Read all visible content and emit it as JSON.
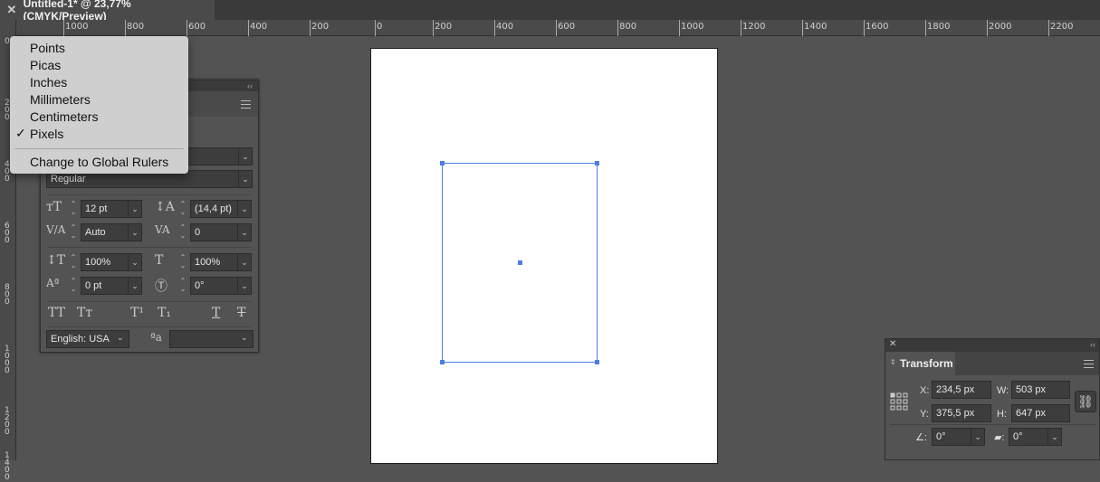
{
  "document_tab": {
    "close_icon": "close-icon",
    "title": "Untitled-1* @ 23,77% (CMYK/Preview)"
  },
  "ruler": {
    "h_labels": [
      "1000",
      "800",
      "600",
      "400",
      "200",
      "0",
      "200",
      "400",
      "600",
      "800",
      "1000",
      "1200",
      "1400",
      "1600",
      "1800",
      "2000",
      "2200"
    ],
    "v_labels": [
      "0",
      "200",
      "400",
      "600",
      "800",
      "1000",
      "1200",
      "1400"
    ]
  },
  "units_menu": {
    "items": [
      "Points",
      "Picas",
      "Inches",
      "Millimeters",
      "Centimeters",
      "Pixels"
    ],
    "checked": "Pixels",
    "check_glyph": "✓",
    "global": "Change to Global Rulers"
  },
  "character_panel": {
    "collapse": "‹‹",
    "font_style": "Regular",
    "font_size": "12 pt",
    "leading": "(14,4 pt)",
    "kerning": "Auto",
    "tracking": "0",
    "vertical_scale": "100%",
    "horizontal_scale": "100%",
    "baseline_shift": "0 pt",
    "rotation": "0°",
    "language": "English: USA",
    "aa_icon": "aa-icon",
    "style_buttons": [
      "TT",
      "Tт",
      "T¹",
      "T₁",
      "T",
      "T"
    ]
  },
  "transform_panel": {
    "title": "Transform",
    "x_label": "X:",
    "x": "234,5 px",
    "y_label": "Y:",
    "y": "375,5 px",
    "w_label": "W:",
    "w": "503 px",
    "h_label": "H:",
    "h": "647 px",
    "rotate": "0°",
    "shear": "0°",
    "collapse": "‹‹"
  },
  "colors": {
    "selection": "#4c7ee5",
    "canvas": "#535353",
    "artboard": "#ffffff"
  }
}
